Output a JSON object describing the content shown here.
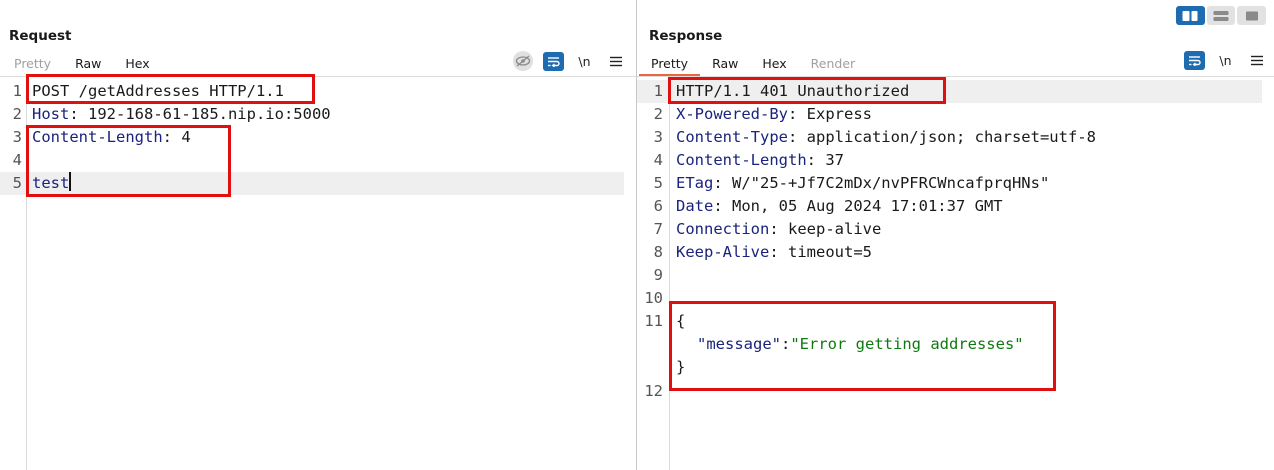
{
  "request": {
    "title": "Request",
    "tabs": [
      {
        "label": "Pretty",
        "state": "disabled"
      },
      {
        "label": "Raw",
        "state": "normal"
      },
      {
        "label": "Hex",
        "state": "normal"
      }
    ],
    "tools": {
      "newline_label": "\\n"
    },
    "lines": [
      {
        "num": "1",
        "key": "POST /getAddresses HTTP/1.1",
        "sep": "",
        "value": ""
      },
      {
        "num": "2",
        "key": "Host",
        "sep": ": ",
        "value": "192-168-61-185.nip.io:5000"
      },
      {
        "num": "3",
        "key": "Content-Length",
        "sep": ": ",
        "value": "4"
      },
      {
        "num": "4",
        "key": "",
        "sep": "",
        "value": ""
      },
      {
        "num": "5",
        "key": "test",
        "sep": "",
        "value": ""
      }
    ]
  },
  "response": {
    "title": "Response",
    "tabs": [
      {
        "label": "Pretty",
        "state": "active"
      },
      {
        "label": "Raw",
        "state": "normal"
      },
      {
        "label": "Hex",
        "state": "normal"
      },
      {
        "label": "Render",
        "state": "disabled"
      }
    ],
    "tools": {
      "newline_label": "\\n"
    },
    "lines": [
      {
        "num": "1",
        "key": "HTTP/1.1 401 Unauthorized",
        "sep": "",
        "value": ""
      },
      {
        "num": "2",
        "key": "X-Powered-By",
        "sep": ": ",
        "value": "Express"
      },
      {
        "num": "3",
        "key": "Content-Type",
        "sep": ": ",
        "value": "application/json; charset=utf-8"
      },
      {
        "num": "4",
        "key": "Content-Length",
        "sep": ": ",
        "value": "37"
      },
      {
        "num": "5",
        "key": "ETag",
        "sep": ": ",
        "value": "W/\"25-+Jf7C2mDx/nvPFRCWncafprqHNs\""
      },
      {
        "num": "6",
        "key": "Date",
        "sep": ": ",
        "value": "Mon, 05 Aug 2024 17:01:37 GMT"
      },
      {
        "num": "7",
        "key": "Connection",
        "sep": ": ",
        "value": "keep-alive"
      },
      {
        "num": "8",
        "key": "Keep-Alive",
        "sep": ": ",
        "value": "timeout=5"
      },
      {
        "num": "9",
        "key": "",
        "sep": "",
        "value": ""
      },
      {
        "num": "10",
        "key": "",
        "sep": "",
        "value": ""
      }
    ],
    "json_line_num_open": "11",
    "json_open": "{",
    "json_key": "\"message\"",
    "json_colon": ":",
    "json_value": "\"Error getting addresses\"",
    "json_close": "}",
    "json_line_num_end": "12"
  },
  "colors": {
    "highlight_box": "#e01010",
    "active_tab": "#e8683c",
    "accent": "#1e6bb0"
  }
}
